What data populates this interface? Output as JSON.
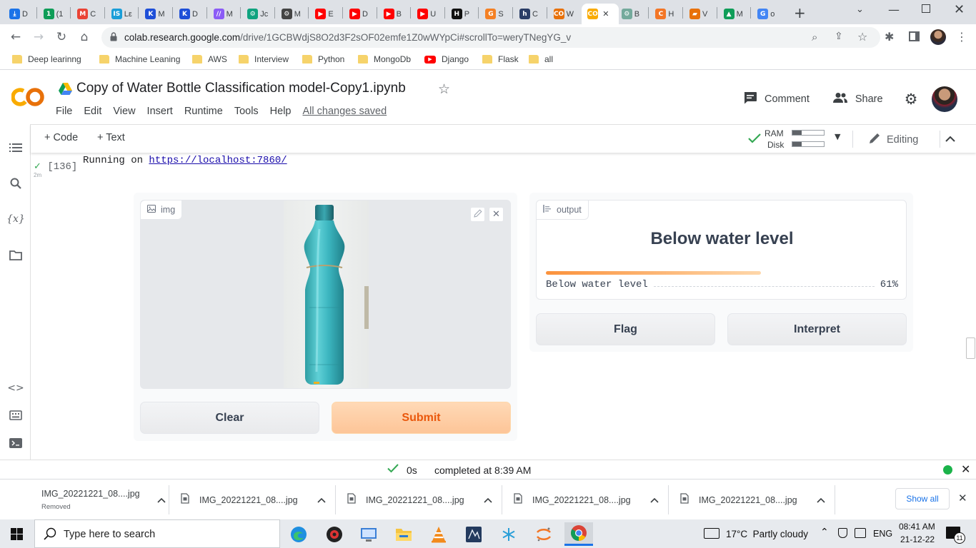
{
  "browser": {
    "tabs": [
      {
        "label": "D",
        "fav": "⤓",
        "color": "#1a73e8"
      },
      {
        "label": "(1",
        "fav": "1",
        "color": "#0f9d58"
      },
      {
        "label": "C",
        "fav": "M",
        "color": "#ea4335"
      },
      {
        "label": "Lε",
        "fav": "IS",
        "color": "#1a9ed8"
      },
      {
        "label": "M",
        "fav": "K",
        "color": "#1e4fd8"
      },
      {
        "label": "D",
        "fav": "K",
        "color": "#1e4fd8"
      },
      {
        "label": "M",
        "fav": "//",
        "color": "#8b5cf6"
      },
      {
        "label": "Jc",
        "fav": "⚙",
        "color": "#10a37f"
      },
      {
        "label": "M",
        "fav": "⚙",
        "color": "#444"
      },
      {
        "label": "E",
        "fav": "▶",
        "color": "#ff0000"
      },
      {
        "label": "D",
        "fav": "▶",
        "color": "#ff0000"
      },
      {
        "label": "B",
        "fav": "▶",
        "color": "#ff0000"
      },
      {
        "label": "U",
        "fav": "▶",
        "color": "#ff0000"
      },
      {
        "label": "P",
        "fav": "H",
        "color": "#111"
      },
      {
        "label": "S",
        "fav": "G",
        "color": "#f48024"
      },
      {
        "label": "C",
        "fav": "h",
        "color": "#2a3d66"
      },
      {
        "label": "W",
        "fav": "CO",
        "color": "#e8710a"
      },
      {
        "label": "",
        "fav": "CO",
        "color": "#f9ab00"
      },
      {
        "label": "B",
        "fav": "⚙",
        "color": "#74aa9c"
      },
      {
        "label": "H",
        "fav": "C",
        "color": "#f37626"
      },
      {
        "label": "V",
        "fav": "▰",
        "color": "#e8710a"
      },
      {
        "label": "M",
        "fav": "▲",
        "color": "#0f9d58"
      },
      {
        "label": "o",
        "fav": "G",
        "color": "#4285f4"
      }
    ],
    "url_host": "colab.research.google.com",
    "url_path": "/drive/1GCBWdjS8O2d3F2sOF02emfe1Z0wWYpCi#scrollTo=weryTNegYG_v",
    "bookmarks": [
      "Deep learinng",
      "Machine Leaning",
      "AWS",
      "Interview",
      "Python",
      "MongoDb",
      "Django",
      "Flask",
      "all"
    ]
  },
  "colab": {
    "title": "Copy of Water Bottle Classification model-Copy1.ipynb",
    "menu": [
      "File",
      "Edit",
      "View",
      "Insert",
      "Runtime",
      "Tools",
      "Help"
    ],
    "saved_status": "All changes saved",
    "comment_label": "Comment",
    "share_label": "Share",
    "add_code": "+ Code",
    "add_text": "+ Text",
    "ram_label": "RAM",
    "disk_label": "Disk",
    "ram_usage": 0.3,
    "disk_usage": 0.3,
    "editing_label": "Editing"
  },
  "cell": {
    "exec_count": "[136]",
    "exec_time": "2m",
    "output_prefix": "Running on ",
    "output_link": "https://localhost:7860/"
  },
  "gradio": {
    "input_label": "img",
    "clear_label": "Clear",
    "submit_label": "Submit",
    "output_label": "output",
    "prediction": "Below water level",
    "confidences": [
      {
        "label": "Below water level",
        "value": "61%",
        "fraction": 0.61
      }
    ],
    "flag_label": "Flag",
    "interpret_label": "Interpret"
  },
  "status": {
    "elapsed": "0s",
    "completed": "completed at 8:39 AM"
  },
  "downloads": {
    "items": [
      {
        "name": "IMG_20221221_08....jpg",
        "sub": "Removed"
      },
      {
        "name": "IMG_20221221_08....jpg",
        "sub": ""
      },
      {
        "name": "IMG_20221221_08....jpg",
        "sub": ""
      },
      {
        "name": "IMG_20221221_08....jpg",
        "sub": ""
      },
      {
        "name": "IMG_20221221_08....jpg",
        "sub": ""
      }
    ],
    "show_all": "Show all"
  },
  "taskbar": {
    "search_placeholder": "Type here to search",
    "weather": "17°C  Partly cloudy",
    "lang": "ENG",
    "time": "08:41 AM",
    "date": "21-12-22",
    "notifications": "11"
  }
}
